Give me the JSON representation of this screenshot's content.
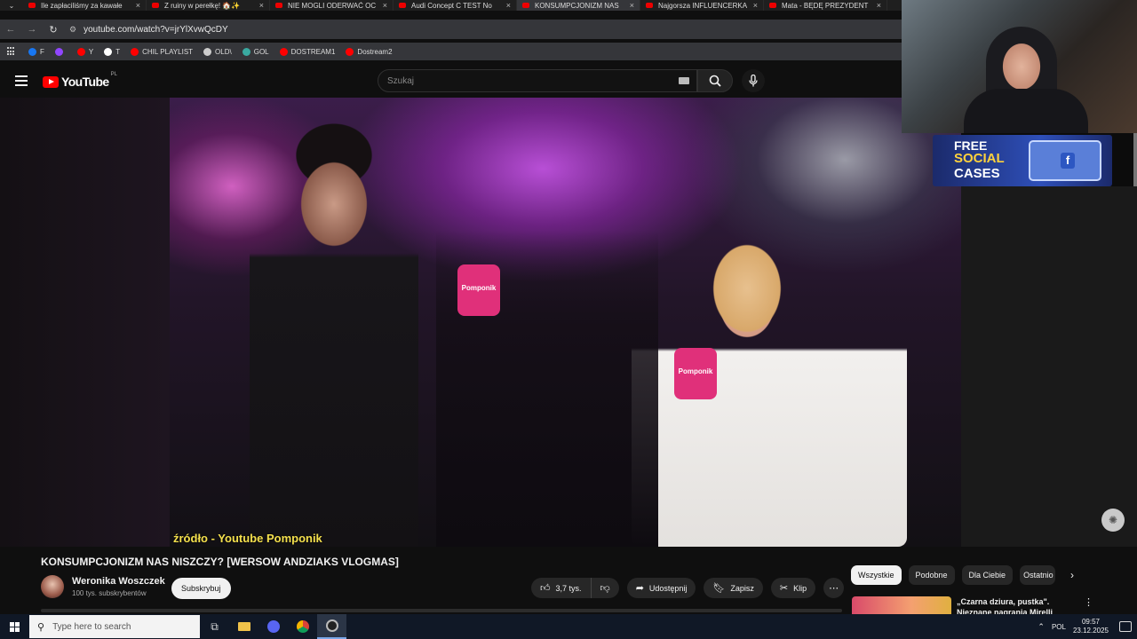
{
  "browser": {
    "tabs": [
      {
        "title": "Ile zapłaciliśmy za kawałe",
        "active": false
      },
      {
        "title": "Z ruiny w perełkę! 🏠✨",
        "active": false
      },
      {
        "title": "NIE MOGLI ODERWAĆ OC",
        "active": false
      },
      {
        "title": "Audi Concept C TEST No",
        "active": false
      },
      {
        "title": "KONSUMPCJONIZM NAS",
        "active": true
      },
      {
        "title": "Najgorsza INFLUENCERKA",
        "active": false
      },
      {
        "title": "Mata - BĘDĘ PREZYDENT",
        "active": false
      }
    ],
    "url": "youtube.com/watch?v=jrYlXvwQcDY",
    "bookmarks": [
      {
        "label": "F",
        "color": "#1877f2"
      },
      {
        "label": "",
        "color": "#9146ff"
      },
      {
        "label": "Y",
        "color": "#ff0000"
      },
      {
        "label": "T",
        "color": "#ffffff"
      },
      {
        "label": "CHIL PLAYLIST",
        "color": "#ff0000"
      },
      {
        "label": "OLD\\",
        "color": "#cccccc"
      },
      {
        "label": "GOL",
        "color": "#3aa9a0"
      },
      {
        "label": "DOSTREAM1",
        "color": "#ff0000"
      },
      {
        "label": "Dostream2",
        "color": "#ff0000"
      }
    ]
  },
  "youtube": {
    "logo_text": "YouTube",
    "country_code": "PL",
    "search_placeholder": "Szukaj"
  },
  "video": {
    "overlay_caption": "źródło - Youtube Pomponik",
    "mic_brand": "Pomponik",
    "title": "KONSUMPCJONIZM NAS NISZCZY? [WERSOW ANDZIAKS VLOGMAS]",
    "channel_name": "Weronika Woszczek",
    "subscribers": "100 tys. subskrybentów",
    "subscribe_label": "Subskrybuj",
    "like_count": "3,7 tys.",
    "share_label": "Udostępnij",
    "save_label": "Zapisz",
    "clip_label": "Klip"
  },
  "banner": {
    "line1": "FREE",
    "line2": "SOCIAL",
    "line3": "CASES"
  },
  "sidebar": {
    "chips": [
      "Wszystkie",
      "Podobne",
      "Dla Ciebie",
      "Ostatnio"
    ],
    "recommended": [
      {
        "title": "„Czarna dziura, pustka\". Nieznane nagrania Mirelli"
      }
    ]
  },
  "taskbar": {
    "search_placeholder": "Type here to search",
    "language": "POL",
    "time": "09:57",
    "date": "23.12.2025"
  }
}
